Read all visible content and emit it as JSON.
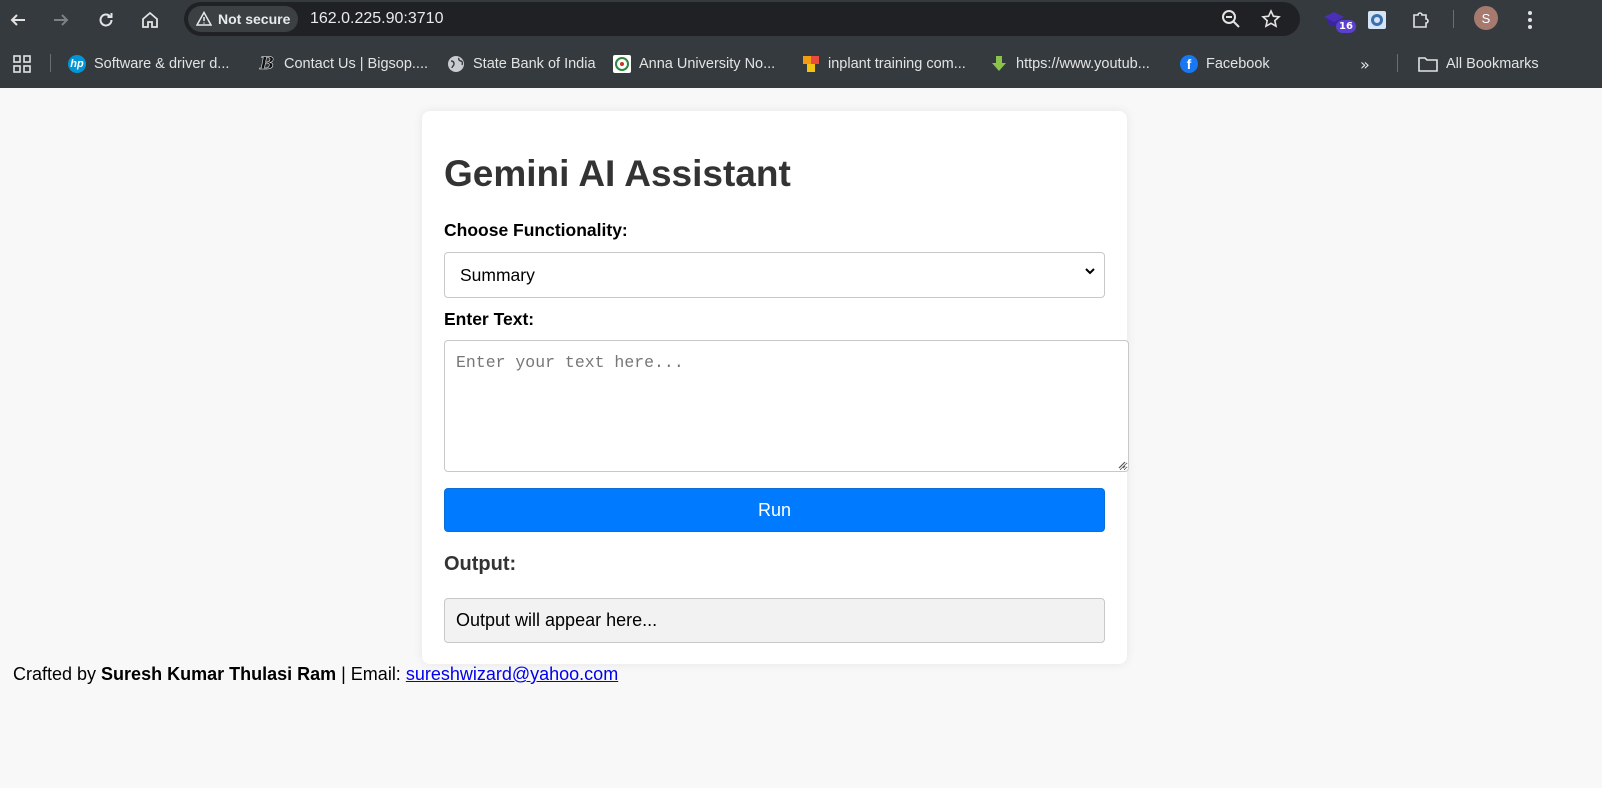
{
  "browser": {
    "security_label": "Not secure",
    "url": "162.0.225.90:3710",
    "extension_badge": "16",
    "profile_initial": "S",
    "bookmarks": [
      {
        "label": "Software & driver d...",
        "icon": "hp-icon"
      },
      {
        "label": "Contact Us | Bigsop....",
        "icon": "bigsop-icon"
      },
      {
        "label": "State Bank of India",
        "icon": "globe-icon"
      },
      {
        "label": "Anna University No...",
        "icon": "anna-university-icon"
      },
      {
        "label": "inplant training com...",
        "icon": "inplant-icon"
      },
      {
        "label": "https://www.youtub...",
        "icon": "download-arrow-icon"
      },
      {
        "label": "Facebook",
        "icon": "facebook-icon"
      }
    ],
    "all_bookmarks_label": "All Bookmarks"
  },
  "page": {
    "title": "Gemini AI Assistant",
    "function_label": "Choose Functionality:",
    "function_selected": "Summary",
    "text_label": "Enter Text:",
    "text_placeholder": "Enter your text here...",
    "run_label": "Run",
    "output_title": "Output:",
    "output_text": "Output will appear here..."
  },
  "footer": {
    "prefix": "Crafted by ",
    "author": "Suresh Kumar Thulasi Ram",
    "separator": " | Email: ",
    "email": "sureshwizard@yahoo.com"
  },
  "colors": {
    "chrome_bg": "#353a3e",
    "omnibox_bg": "#202124",
    "primary_button": "#007bff",
    "link": "#0000ee"
  }
}
